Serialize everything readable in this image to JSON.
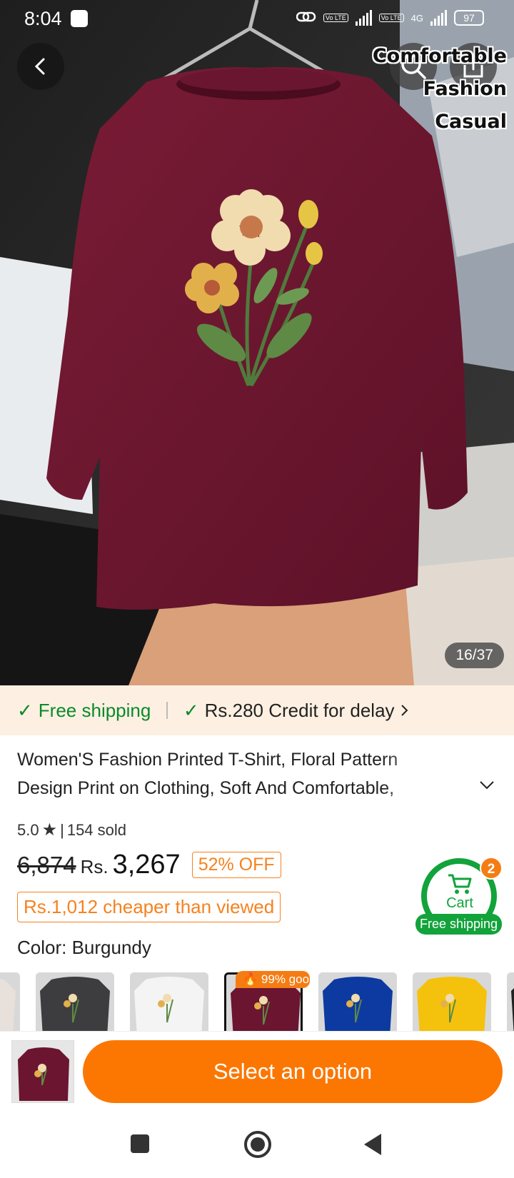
{
  "status_bar": {
    "time": "8:04",
    "lte1": "Vo LTE",
    "lte2": "Vo LTE",
    "net": "4G",
    "battery": "97"
  },
  "hero": {
    "overlay_lines": [
      "Comfortable",
      "Fashion",
      "Casual"
    ],
    "counter": "16/37"
  },
  "shipping": {
    "free": "Free shipping",
    "credit": "Rs.280 Credit for delay"
  },
  "product": {
    "title": "Women'S Fashion Printed T-Shirt, Floral Pattern Design Print on Clothing, Soft And Comfortable,",
    "rating": "5.0",
    "sold": "154 sold",
    "old_price": "6,874",
    "currency": "Rs.",
    "price": "3,267",
    "discount": "52% OFF",
    "cheaper": "Rs.1,012 cheaper than viewed",
    "color_label": "Color: Burgundy",
    "swatch_tag": "99% goo"
  },
  "cart": {
    "label": "Cart",
    "count": "2",
    "free_shipping": "Free shipping"
  },
  "swatch_colors": [
    "#e8e0da",
    "#3d3d3f",
    "#f4f4f4",
    "#6b1530",
    "#0d3aa0",
    "#f4c20d",
    "#222"
  ],
  "bottom": {
    "select_label": "Select an option"
  },
  "colors": {
    "accent": "#fb7701",
    "green": "#12a33b",
    "burgundy": "#6b1530"
  }
}
